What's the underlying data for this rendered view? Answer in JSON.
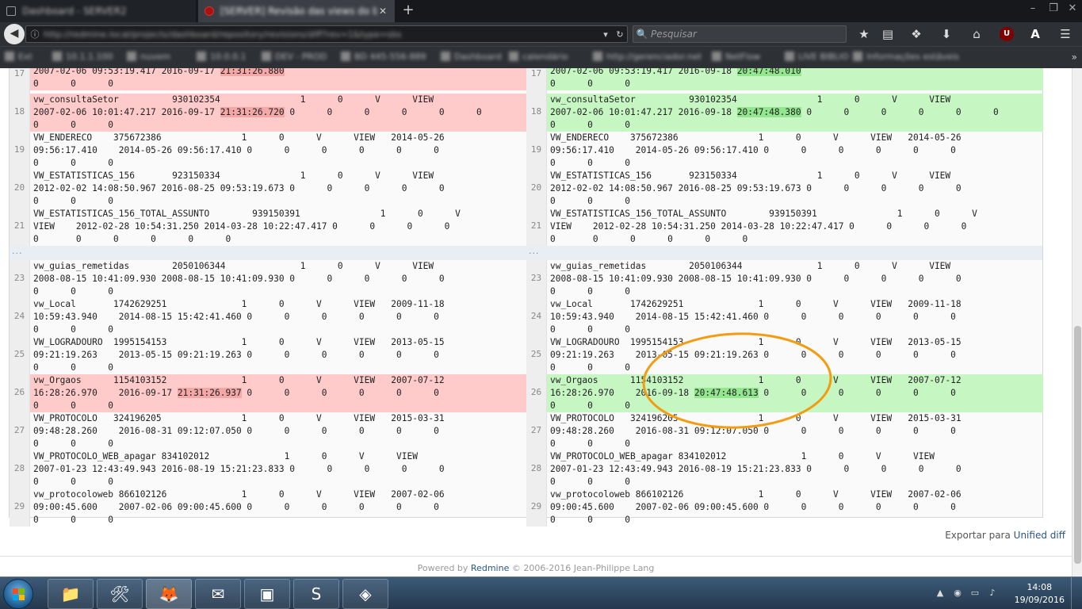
{
  "browser": {
    "tabs": [
      {
        "title": "Dashboard - SERVER2"
      },
      {
        "title": "[SERVER] Revisão das views do banco"
      }
    ],
    "url": "http://redmine.local/projects/dashboard/repository/revisions/diff?rev=1&type=sbs",
    "search_placeholder": "Pesquisar",
    "bookmarks": [
      "Ext",
      "10.1.1.100",
      "nuvem",
      "10.0.0.1",
      "DEV - PROD",
      "BD 445-556-889",
      "Dashboard",
      "calendário",
      "http://gerenciador.net",
      "NetFlow",
      "LIVE BIBLIO",
      "Informações estáveis"
    ]
  },
  "diff": {
    "rows": [
      {
        "type": "partial",
        "ln": "17",
        "kind": "change",
        "left": [
          [
            {
              "t": "2007-02-06 09:53:19.417 2016-09-17 "
            },
            {
              "t": "21:31:26.880",
              "hl": true
            }
          ],
          [
            {
              "t": "0      0      0"
            }
          ]
        ],
        "right": [
          [
            {
              "t": "2007-02-06 09:53:19.417 2016-09-18 "
            },
            {
              "t": "20:47:48.010",
              "hl": true
            }
          ],
          [
            {
              "t": "0      0      0"
            }
          ]
        ]
      },
      {
        "type": "row",
        "ln": "18",
        "kind": "change",
        "left": [
          [
            {
              "t": "vw_consultaSetor          930102354               1      0      V      VIEW"
            }
          ],
          [
            {
              "t": "2007-02-06 10:01:47.217 2016-09-17 "
            },
            {
              "t": "21:31:26.720",
              "hl": true
            },
            {
              "t": " 0      0      0      0      0      0"
            }
          ],
          [
            {
              "t": "0      0      0"
            }
          ]
        ],
        "right": [
          [
            {
              "t": "vw_consultaSetor          930102354               1      0      V      VIEW"
            }
          ],
          [
            {
              "t": "2007-02-06 10:01:47.217 2016-09-18 "
            },
            {
              "t": "20:47:48.380",
              "hl": true
            },
            {
              "t": " 0      0      0      0      0      0"
            }
          ],
          [
            {
              "t": "0      0      0"
            }
          ]
        ]
      },
      {
        "type": "row",
        "ln": "19",
        "kind": "same",
        "left": [
          [
            {
              "t": "VW_ENDERECO    375672386               1      0      V      VIEW   2014-05-26"
            }
          ],
          [
            {
              "t": "09:56:17.410    2014-05-26 09:56:17.410 0      0      0      0      0      0"
            }
          ],
          [
            {
              "t": "0      0      0"
            }
          ]
        ],
        "right": [
          [
            {
              "t": "VW_ENDERECO    375672386               1      0      V      VIEW   2014-05-26"
            }
          ],
          [
            {
              "t": "09:56:17.410    2014-05-26 09:56:17.410 0      0      0      0      0      0"
            }
          ],
          [
            {
              "t": "0      0      0"
            }
          ]
        ]
      },
      {
        "type": "row",
        "ln": "20",
        "kind": "same",
        "left": [
          [
            {
              "t": "VW_ESTATISTICAS_156       923150334               1      0      V      VIEW"
            }
          ],
          [
            {
              "t": "2012-02-02 14:08:50.967 2016-08-25 09:53:19.673 0      0      0      0      0"
            }
          ],
          [
            {
              "t": "0      0      0"
            }
          ]
        ],
        "right": [
          [
            {
              "t": "VW_ESTATISTICAS_156       923150334               1      0      V      VIEW"
            }
          ],
          [
            {
              "t": "2012-02-02 14:08:50.967 2016-08-25 09:53:19.673 0      0      0      0      0"
            }
          ],
          [
            {
              "t": "0      0      0"
            }
          ]
        ]
      },
      {
        "type": "row",
        "ln": "21",
        "kind": "same",
        "left": [
          [
            {
              "t": "VW_ESTATISTICAS_156_TOTAL_ASSUNTO        939150391               1      0      V"
            }
          ],
          [
            {
              "t": "VIEW    2012-02-28 10:54:31.250 2014-03-28 10:22:47.417 0      0      0      0"
            }
          ],
          [
            {
              "t": "0       0      0      0      0      0"
            }
          ]
        ],
        "right": [
          [
            {
              "t": "VW_ESTATISTICAS_156_TOTAL_ASSUNTO        939150391               1      0      V"
            }
          ],
          [
            {
              "t": "VIEW    2012-02-28 10:54:31.250 2014-03-28 10:22:47.417 0      0      0      0"
            }
          ],
          [
            {
              "t": "0       0      0      0      0      0"
            }
          ]
        ]
      },
      {
        "type": "sep",
        "dots": "..."
      },
      {
        "type": "row",
        "ln": "23",
        "kind": "same",
        "left": [
          [
            {
              "t": "vw_guias_remetidas        2050106344              1      0      V      VIEW"
            }
          ],
          [
            {
              "t": "2008-08-15 10:41:09.930 2008-08-15 10:41:09.930 0      0      0      0      0"
            }
          ],
          [
            {
              "t": "0      0      0"
            }
          ]
        ],
        "right": [
          [
            {
              "t": "vw_guias_remetidas        2050106344              1      0      V      VIEW"
            }
          ],
          [
            {
              "t": "2008-08-15 10:41:09.930 2008-08-15 10:41:09.930 0      0      0      0      0"
            }
          ],
          [
            {
              "t": "0      0      0"
            }
          ]
        ]
      },
      {
        "type": "row",
        "ln": "24",
        "kind": "same",
        "left": [
          [
            {
              "t": "vw_Local       1742629251              1      0      V      VIEW   2009-11-18"
            }
          ],
          [
            {
              "t": "10:59:43.940    2014-08-15 15:42:41.460 0      0      0      0      0      0"
            }
          ],
          [
            {
              "t": "0      0      0"
            }
          ]
        ],
        "right": [
          [
            {
              "t": "vw_Local       1742629251              1      0      V      VIEW   2009-11-18"
            }
          ],
          [
            {
              "t": "10:59:43.940    2014-08-15 15:42:41.460 0      0      0      0      0      0"
            }
          ],
          [
            {
              "t": "0      0      0"
            }
          ]
        ]
      },
      {
        "type": "row",
        "ln": "25",
        "kind": "same",
        "left": [
          [
            {
              "t": "VW_LOGRADOURO  1995154153              1      0      V      VIEW   2013-05-15"
            }
          ],
          [
            {
              "t": "09:21:19.263    2013-05-15 09:21:19.263 0      0      0      0      0      0"
            }
          ],
          [
            {
              "t": "0      0      0"
            }
          ]
        ],
        "right": [
          [
            {
              "t": "VW_LOGRADOURO  1995154153              1      0      V      VIEW   2013-05-15"
            }
          ],
          [
            {
              "t": "09:21:19.263    2013-05-15 09:21:19.263 0      0      0      0      0      0"
            }
          ],
          [
            {
              "t": "0      0      0"
            }
          ]
        ]
      },
      {
        "type": "row",
        "ln": "26",
        "kind": "change",
        "left": [
          [
            {
              "t": "vw_Orgaos      1154103152              1      0      V      VIEW   2007-07-12"
            }
          ],
          [
            {
              "t": "16:28:26.970    2016-09-17 "
            },
            {
              "t": "21:31:26.937",
              "hl": true
            },
            {
              "t": " 0      0      0      0      0      0"
            }
          ],
          [
            {
              "t": "0      0      0"
            }
          ]
        ],
        "right": [
          [
            {
              "t": "vw_Orgaos      1154103152              1      0      V      VIEW   2007-07-12"
            }
          ],
          [
            {
              "t": "16:28:26.970    2016-09-18 "
            },
            {
              "t": "20:47:48.613",
              "hl": true
            },
            {
              "t": " 0      0      0      0      0      0"
            }
          ],
          [
            {
              "t": "0      0      0"
            }
          ]
        ]
      },
      {
        "type": "row",
        "ln": "27",
        "kind": "same",
        "left": [
          [
            {
              "t": "VW_PROTOCOLO   324196205               1      0      V      VIEW   2015-03-31"
            }
          ],
          [
            {
              "t": "09:48:28.260    2016-08-31 09:12:07.050 0      0      0      0      0      0"
            }
          ],
          [
            {
              "t": "0      0      0"
            }
          ]
        ],
        "right": [
          [
            {
              "t": "VW_PROTOCOLO   324196205               1      0      V      VIEW   2015-03-31"
            }
          ],
          [
            {
              "t": "09:48:28.260    2016-08-31 09:12:07.050 0      0      0      0      0      0"
            }
          ],
          [
            {
              "t": "0      0      0"
            }
          ]
        ]
      },
      {
        "type": "row",
        "ln": "28",
        "kind": "same",
        "left": [
          [
            {
              "t": "VW_PROTOCOLO_WEB_apagar 834102012              1      0      V      VIEW"
            }
          ],
          [
            {
              "t": "2007-01-23 12:43:49.943 2016-08-19 15:21:23.833 0      0      0      0      0"
            }
          ],
          [
            {
              "t": "0      0      0"
            }
          ]
        ],
        "right": [
          [
            {
              "t": "VW_PROTOCOLO_WEB_apagar 834102012              1      0      V      VIEW"
            }
          ],
          [
            {
              "t": "2007-01-23 12:43:49.943 2016-08-19 15:21:23.833 0      0      0      0      0"
            }
          ],
          [
            {
              "t": "0      0      0"
            }
          ]
        ]
      },
      {
        "type": "row",
        "ln": "29",
        "kind": "same",
        "left": [
          [
            {
              "t": "vw_protocoloweb 866102126              1      0      V      VIEW   2007-02-06"
            }
          ],
          [
            {
              "t": "09:00:45.600    2007-02-06 09:00:45.600 0      0      0      0      0      0"
            }
          ],
          [
            {
              "t": "0      0      0"
            }
          ]
        ],
        "right": [
          [
            {
              "t": "vw_protocoloweb 866102126              1      0      V      VIEW   2007-02-06"
            }
          ],
          [
            {
              "t": "09:00:45.600    2007-02-06 09:00:45.600 0      0      0      0      0      0"
            }
          ],
          [
            {
              "t": "0      0      0"
            }
          ]
        ]
      }
    ]
  },
  "export": {
    "label": "Exportar para",
    "link": "Unified diff"
  },
  "footer": {
    "prefix": "Powered by",
    "link": "Redmine",
    "suffix": "© 2006-2016 Jean-Philippe Lang"
  },
  "colors": {
    "deleted": "#ffcaca",
    "added": "#c6f7c3",
    "annotation": "#f39c12"
  },
  "taskbar": {
    "apps": [
      "explorer-icon",
      "tools-icon",
      "firefox-icon",
      "thunderbird-icon",
      "terminal-icon",
      "skype-icon",
      "virtualbox-icon"
    ],
    "time": "14:08",
    "date": "19/09/2016"
  }
}
